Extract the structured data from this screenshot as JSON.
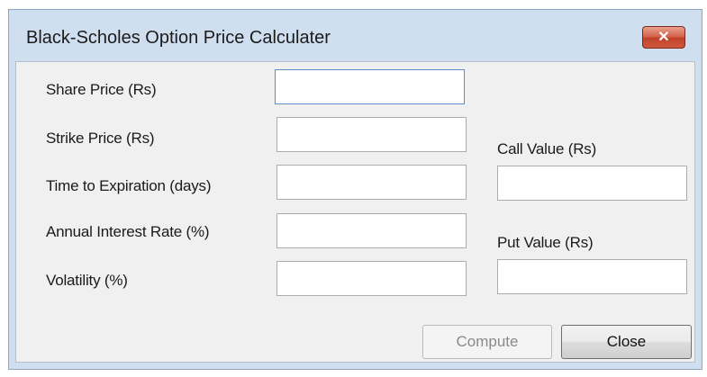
{
  "window": {
    "title": "Black-Scholes Option Price Calculater",
    "close_glyph": "✕"
  },
  "form": {
    "inputs": [
      {
        "label": "Share Price (Rs)",
        "value": ""
      },
      {
        "label": "Strike Price (Rs)",
        "value": ""
      },
      {
        "label": "Time to Expiration (days)",
        "value": ""
      },
      {
        "label": "Annual Interest Rate (%)",
        "value": ""
      },
      {
        "label": "Volatility (%)",
        "value": ""
      }
    ]
  },
  "results": {
    "call_label": "Call Value (Rs)",
    "call_value": "",
    "put_label": "Put Value (Rs)",
    "put_value": ""
  },
  "buttons": {
    "compute": "Compute",
    "close": "Close"
  },
  "colors": {
    "frame": "#cfdff0",
    "client_bg": "#f0f0f0",
    "close_red": "#c0412a",
    "focus_border": "#5b8fc7"
  }
}
